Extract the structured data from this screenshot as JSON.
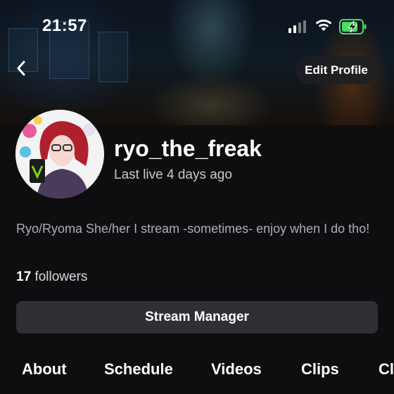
{
  "status_bar": {
    "time": "21:57",
    "icons": [
      "cellular-signal-icon",
      "wifi-icon",
      "battery-charging-icon"
    ],
    "battery_color": "#4cd964"
  },
  "header": {
    "back_icon": "chevron-left-icon",
    "edit_profile_label": "Edit Profile"
  },
  "profile": {
    "username": "ryo_the_freak",
    "last_live": "Last live 4 days ago",
    "bio": "Ryo/Ryoma She/her I stream -sometimes- enjoy when I do tho!",
    "followers_count": "17",
    "followers_label": "followers"
  },
  "actions": {
    "stream_manager_label": "Stream Manager"
  },
  "tabs": [
    {
      "label": "About"
    },
    {
      "label": "Schedule"
    },
    {
      "label": "Videos"
    },
    {
      "label": "Clips"
    },
    {
      "label": "Cl"
    }
  ],
  "colors": {
    "background": "#0e0e10",
    "button_bg": "#2f2f35",
    "text_primary": "#ffffff",
    "text_secondary": "#adadb8"
  }
}
